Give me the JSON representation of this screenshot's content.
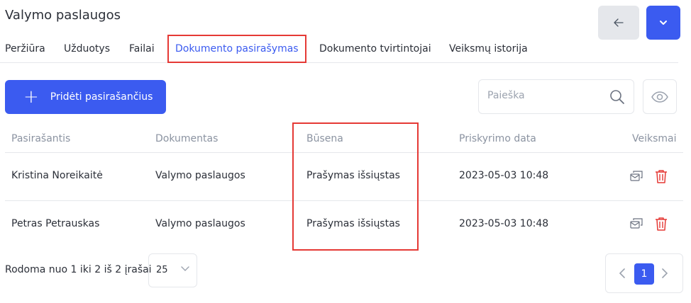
{
  "header": {
    "title": "Valymo paslaugos"
  },
  "tabs": [
    {
      "label": "Peržiūra"
    },
    {
      "label": "Užduotys"
    },
    {
      "label": "Failai"
    },
    {
      "label": "Dokumento pasirašymas",
      "active": true
    },
    {
      "label": "Dokumento tvirtintojai"
    },
    {
      "label": "Veiksmų istorija"
    }
  ],
  "toolbar": {
    "add_label": "Pridėti pasirašančius",
    "search_placeholder": "Paieška"
  },
  "table": {
    "columns": [
      "Pasirašantis",
      "Dokumentas",
      "Būsena",
      "Priskyrimo data",
      "Veiksmai"
    ],
    "rows": [
      {
        "signer": "Kristina Noreikaitė",
        "document": "Valymo paslaugos",
        "status": "Prašymas išsiųstas",
        "date": "2023-05-03 10:48"
      },
      {
        "signer": "Petras Petrauskas",
        "document": "Valymo paslaugos",
        "status": "Prašymas išsiųstas",
        "date": "2023-05-03 10:48"
      }
    ]
  },
  "footer": {
    "info": "Rodoma nuo 1 iki 2 iš 2 įrašai",
    "per_page": "25",
    "current_page": "1"
  },
  "icons": {
    "back": "arrow-left-icon",
    "menu": "chevron-down-icon",
    "search": "search-icon",
    "eye": "eye-icon",
    "resend": "mail-forward-icon",
    "delete": "trash-icon"
  },
  "colors": {
    "primary": "#3b5bf0",
    "danger": "#e53935",
    "muted": "#8b93a1",
    "border": "#e5e7eb"
  }
}
